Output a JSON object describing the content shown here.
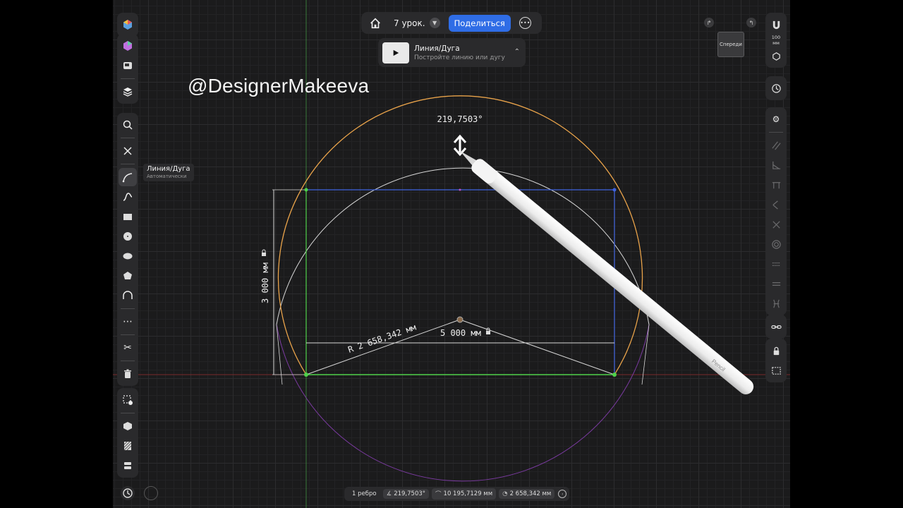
{
  "top_bar": {
    "project_name": "7 урок.",
    "share_label": "Поделиться"
  },
  "hint": {
    "title": "Линия/Дуга",
    "subtitle": "Постройте линию или дугу"
  },
  "watermark": "@DesignerMakeeva",
  "tool_tip": {
    "title": "Линия/Дуга",
    "mode": "Автоматически"
  },
  "view_cube": {
    "label": "Спереди"
  },
  "right_toolbar": {
    "scale_value": "100",
    "scale_unit": "мм"
  },
  "canvas": {
    "angle_label": "219,7503°",
    "radius_label": "R 2 658,342 мм",
    "width_label": "5 000 мм",
    "height_label": "3 000 мм"
  },
  "pencil_brand": "Pencil",
  "status_bar": {
    "edges": "1 ребро",
    "angle": "219,7503°",
    "length": "10 195,7129 мм",
    "radius": "2 658,342 мм"
  },
  "icons": {
    "home": "home-icon",
    "chevron": "chevron-down-icon",
    "more": "more-icon",
    "play": "play-icon",
    "magnet": "magnet-icon",
    "settings": "gear-icon",
    "lock": "lock-icon",
    "scissors": "scissors-icon",
    "trash": "trash-icon"
  },
  "colors": {
    "accent": "#2f6de6",
    "arc": "#e9a34a",
    "guide_circle": "#d8d8d8",
    "rect_top": "#3f63e0",
    "rect_left_base": "#4fd24a",
    "lower_circle": "#7a3aa0"
  }
}
